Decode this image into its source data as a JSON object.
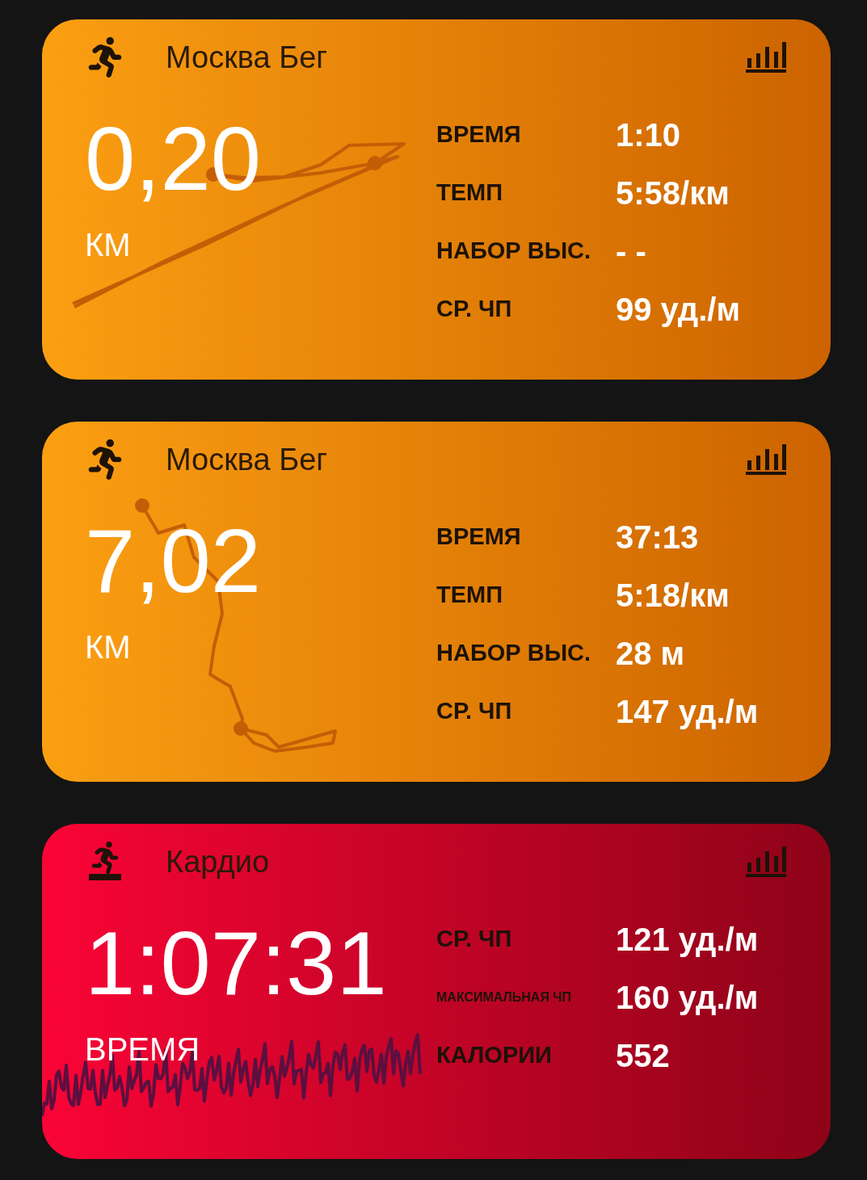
{
  "cards": [
    {
      "kind": "run",
      "title": "Москва Бег",
      "main_value": "0,20",
      "main_unit": "КМ",
      "stats": [
        {
          "kind": "normal",
          "label": "ВРЕМЯ",
          "value": "1:10"
        },
        {
          "kind": "normal",
          "label": "ТЕМП",
          "value": "5:58/км"
        },
        {
          "kind": "normal",
          "label": "НАБОР ВЫС.",
          "value": "- -"
        },
        {
          "kind": "normal",
          "label": "СР. ЧП",
          "value": "99 уд./м"
        }
      ]
    },
    {
      "kind": "run",
      "title": "Москва Бег",
      "main_value": "7,02",
      "main_unit": "КМ",
      "stats": [
        {
          "kind": "normal",
          "label": "ВРЕМЯ",
          "value": "37:13"
        },
        {
          "kind": "normal",
          "label": "ТЕМП",
          "value": "5:18/км"
        },
        {
          "kind": "normal",
          "label": "НАБОР ВЫС.",
          "value": "28 м"
        },
        {
          "kind": "normal",
          "label": "СР. ЧП",
          "value": "147 уд./м"
        }
      ]
    },
    {
      "kind": "cardio",
      "title": "Кардио",
      "main_value": "1:07:31",
      "main_unit": "ВРЕМЯ",
      "stats": [
        {
          "kind": "normal",
          "label": "СР. ЧП",
          "value": "121 уд./м"
        },
        {
          "kind": "small",
          "label": "МАКСИМАЛЬНАЯ ЧП",
          "value": "160 уд./м"
        },
        {
          "kind": "normal",
          "label": "КАЛОРИИ",
          "value": "552"
        }
      ]
    }
  ]
}
